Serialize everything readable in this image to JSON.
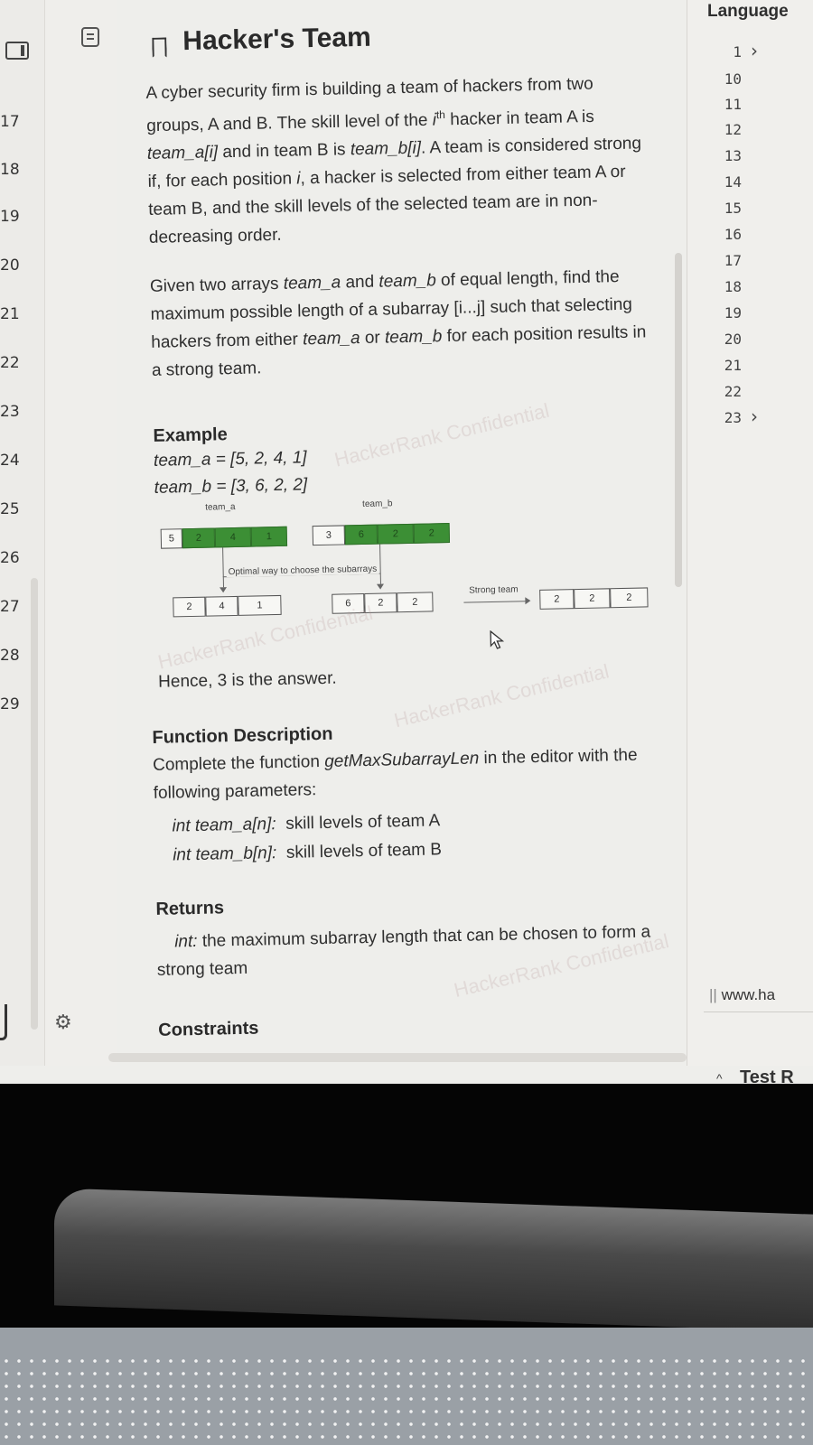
{
  "gutter": {
    "numbers": [
      "17",
      "18",
      "19",
      "20",
      "21",
      "22",
      "23",
      "24",
      "25",
      "26",
      "27",
      "28",
      "29"
    ]
  },
  "problem": {
    "title": "Hacker's Team",
    "para1_parts": [
      "A cyber security firm is building a team of hackers from two groups, A and B. The skill level of the ",
      "i",
      "th",
      " hacker in team A is ",
      "team_a[i]",
      " and in team B is ",
      "team_b[i]",
      ". A team is considered strong if, for each position ",
      "i",
      ", a hacker is selected from either team A or team B, and the skill levels of the selected team are in non-decreasing order."
    ],
    "para2_parts": [
      "Given two arrays ",
      "team_a",
      " and ",
      "team_b",
      " of equal length, find the maximum possible length of a subarray ",
      "[i...j]",
      " such that selecting hackers from either ",
      "team_a",
      " or ",
      "team_b",
      " for each position results in a strong team."
    ],
    "example_title": "Example",
    "example_team_a": "team_a = [5, 2, 4, 1]",
    "example_team_b": "team_b = [3, 6, 2, 2]",
    "diagram": {
      "label_team_a": "team_a",
      "label_team_b": "team_b",
      "top_a": [
        "5",
        "2",
        "4",
        "1"
      ],
      "top_b": [
        "3",
        "6",
        "2",
        "2"
      ],
      "optimal_label": "Optimal way to choose the subarrays",
      "bottom_a": [
        "2",
        "4",
        "1"
      ],
      "bottom_b": [
        "6",
        "2",
        "2"
      ],
      "strong_label": "Strong team",
      "result": [
        "2",
        "2",
        "2"
      ]
    },
    "answer": "Hence, 3 is the answer.",
    "function_title": "Function Description",
    "function_desc_parts": [
      "Complete the function ",
      "getMaxSubarrayLen",
      " in the editor with the following parameters:"
    ],
    "param1_name": "int team_a[n]:",
    "param1_desc": "skill levels of team A",
    "param2_name": "int team_b[n]:",
    "param2_desc": "skill levels of team B",
    "returns_title": "Returns",
    "returns_type": "int:",
    "returns_desc": " the maximum subarray length that can be chosen to form a strong team",
    "constraints_title": "Constraints"
  },
  "watermarks": [
    "HackerRank Confidential",
    "HackerRank Confidential",
    "HackerRank Confidential",
    "HackerRank Confidential"
  ],
  "editor": {
    "language_label": "Language",
    "line_numbers": [
      "1",
      "10",
      "11",
      "12",
      "13",
      "14",
      "15",
      "16",
      "17",
      "18",
      "19",
      "20",
      "21",
      "22",
      "23"
    ],
    "url_text": "www.ha",
    "test_label": "Test R"
  }
}
